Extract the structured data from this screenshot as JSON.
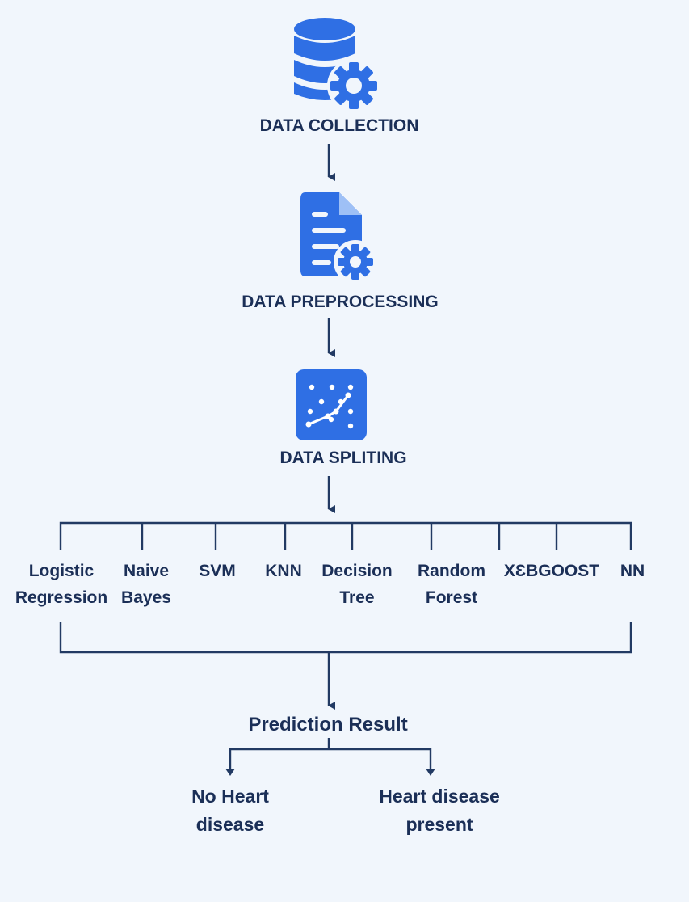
{
  "diagram": {
    "stages": [
      {
        "id": "collection",
        "label": "DATA COLLECTION",
        "icon": "database-gear-icon"
      },
      {
        "id": "preprocessing",
        "label": "DATA PREPROCESSING",
        "icon": "document-gear-icon"
      },
      {
        "id": "splitting",
        "label": "DATA SPLITING",
        "icon": "scatter-chart-icon"
      }
    ],
    "models": [
      {
        "line1": "Logistic",
        "line2": "Regression"
      },
      {
        "line1": "Naive",
        "line2": "Bayes"
      },
      {
        "line1": "SVM",
        "line2": ""
      },
      {
        "line1": "KNN",
        "line2": ""
      },
      {
        "line1": "Decision",
        "line2": "Tree"
      },
      {
        "line1": "Random",
        "line2": "Forest"
      },
      {
        "line1": "XԐBGOOST",
        "line2": ""
      },
      {
        "line1": "NN",
        "line2": ""
      }
    ],
    "result": "Prediction Result",
    "outcomes": [
      {
        "line1": "No Heart",
        "line2": "disease"
      },
      {
        "line1": "Heart disease",
        "line2": "present"
      }
    ]
  },
  "colors": {
    "background": "#f1f6fc",
    "icon_blue": "#2f6fe4",
    "text_navy": "#1b2f57",
    "line_navy": "#223a63"
  }
}
